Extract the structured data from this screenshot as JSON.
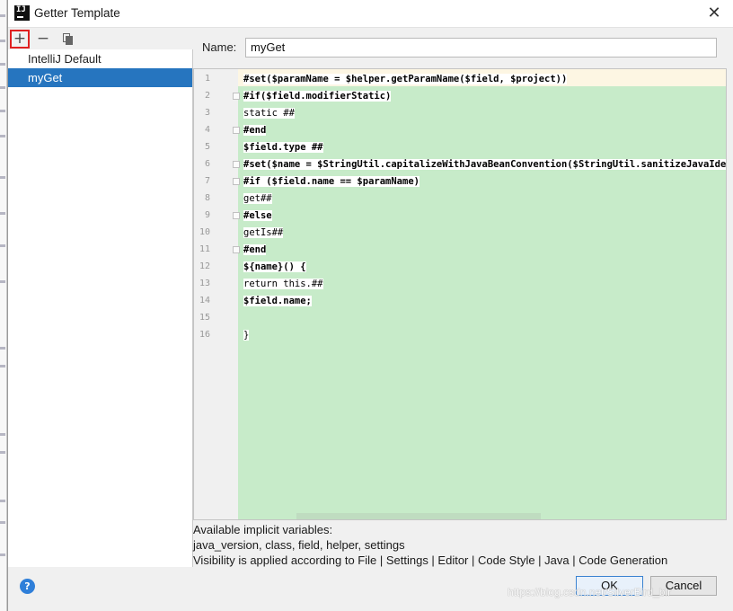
{
  "window": {
    "title": "Getter Template",
    "app_icon": "intellij-icon",
    "close_glyph": "✕"
  },
  "toolbar": {
    "add_glyph": "+",
    "remove_glyph": "−",
    "copy_icon": "copy-icon"
  },
  "templates": [
    {
      "label": "IntelliJ Default",
      "selected": false
    },
    {
      "label": "myGet",
      "selected": true
    }
  ],
  "name_field": {
    "label": "Name:",
    "value": "myGet"
  },
  "editor": {
    "line_numbers": [
      "1",
      "2",
      "3",
      "4",
      "5",
      "6",
      "7",
      "8",
      "9",
      "10",
      "11",
      "12",
      "13",
      "14",
      "15",
      "16"
    ],
    "lines": [
      "#set($paramName = $helper.getParamName($field, $project))",
      "#if($field.modifierStatic)",
      "static ##",
      "#end",
      "$field.type ##",
      "#set($name = $StringUtil.capitalizeWithJavaBeanConvention($StringUtil.sanitizeJavaIdentifi",
      "#if ($field.name == $paramName)",
      "get##",
      "#else",
      "getIs##",
      "#end",
      "${name}() {",
      "return this.##",
      "$field.name;",
      "",
      "}"
    ]
  },
  "info": {
    "line1": "Available implicit variables:",
    "line2": "java_version, class, field, helper, settings",
    "line3": "Visibility is applied according to File | Settings | Editor | Code Style | Java | Code Generation"
  },
  "buttons": {
    "help": "?",
    "ok": "OK",
    "cancel": "Cancel"
  },
  "watermark": "https://blog.csdn.net/SilverBird_blr"
}
